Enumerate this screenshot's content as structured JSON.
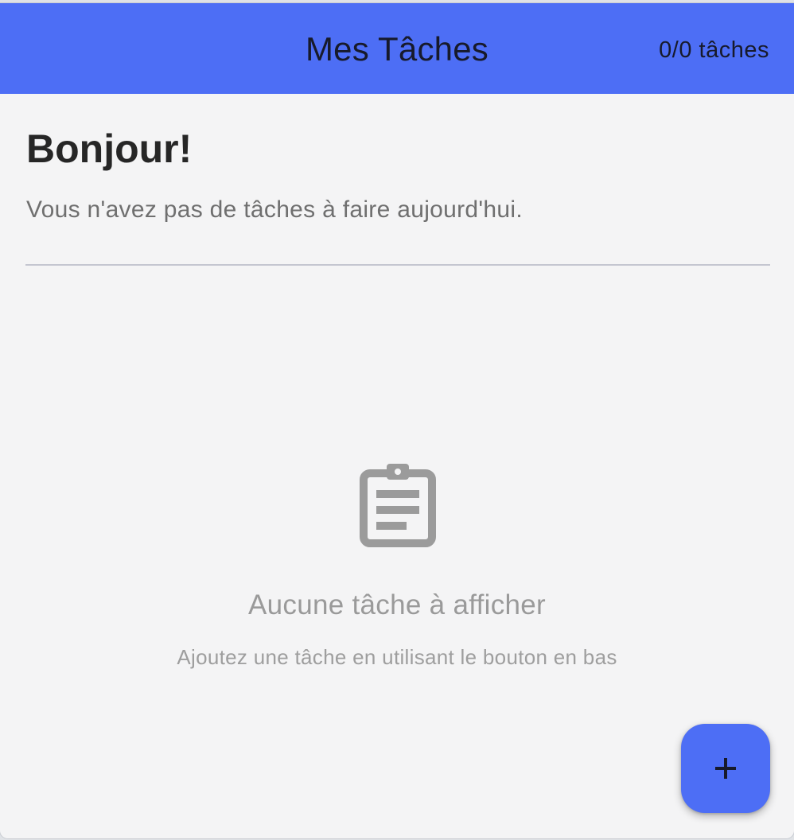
{
  "app_bar": {
    "title": "Mes Tâches",
    "task_count": "0/0 tâches",
    "background_color": "#4d6ef5"
  },
  "header": {
    "greeting": "Bonjour!",
    "summary": "Vous n'avez pas de tâches à faire aujourd'hui."
  },
  "empty_state": {
    "icon": "clipboard-icon",
    "title": "Aucune tâche à afficher",
    "hint": "Ajoutez une tâche en utilisant le bouton en bas"
  },
  "fab": {
    "icon": "add-icon",
    "accent_color": "#4d6ef5"
  }
}
